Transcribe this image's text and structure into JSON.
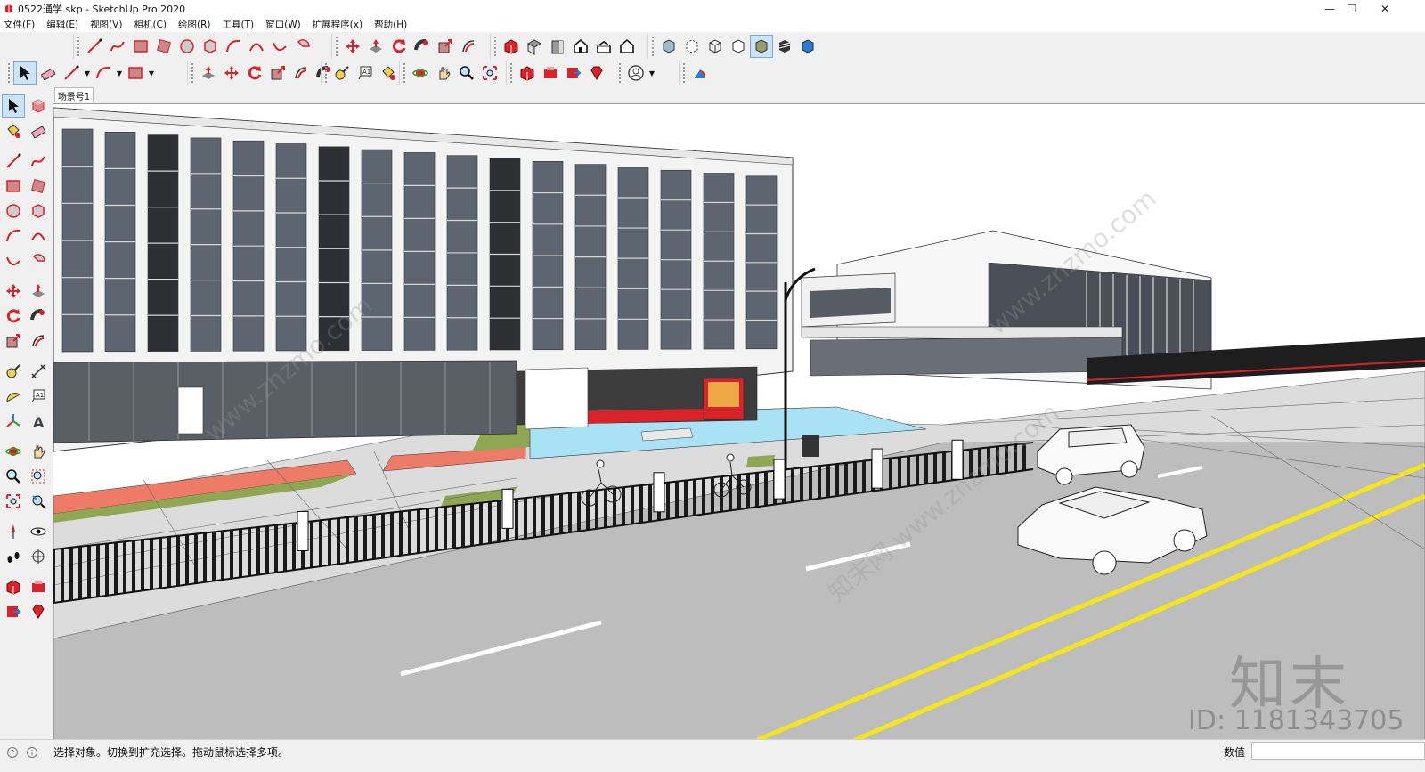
{
  "window": {
    "title": "0522通学.skp - SketchUp Pro 2020",
    "controls": [
      "minimize-icon",
      "restore-icon",
      "close-icon"
    ]
  },
  "menubar": {
    "items": [
      "文件(F)",
      "编辑(E)",
      "视图(V)",
      "相机(C)",
      "绘图(R)",
      "工具(T)",
      "窗口(W)",
      "扩展程序(x)",
      "帮助(H)"
    ]
  },
  "toolbars": {
    "top_row1_groups": [
      [
        "line-icon",
        "freehand-icon",
        "rectangle-icon",
        "rotated-rectangle-icon",
        "circle-icon",
        "polygon-icon",
        "arc-icon",
        "two-point-arc-icon",
        "three-point-arc-icon",
        "pie-icon"
      ],
      [
        "move-icon",
        "push-pull-icon",
        "rotate-icon",
        "follow-me-icon",
        "scale-icon",
        "offset-icon"
      ],
      [
        "warehouse-icon",
        "top-view-icon",
        "front-view-icon",
        "right-view-icon",
        "back-view-icon",
        "left-view-icon"
      ],
      [
        "xray-icon",
        "back-edges-icon",
        "wireframe-icon",
        "hidden-line-icon",
        "shaded-icon",
        "shaded-textures-icon",
        "monochrome-icon"
      ]
    ],
    "top_row2_groups": [
      [
        "select-icon",
        "eraser-icon",
        "line-icon",
        "arc-icon",
        "rectangle-icon"
      ],
      [
        "push-pull-icon",
        "move-icon",
        "rotate-icon",
        "scale-icon",
        "offset-icon",
        "follow-me-icon"
      ],
      [
        "tape-measure-icon",
        "text-icon",
        "paint-bucket-icon"
      ],
      [
        "orbit-icon",
        "pan-icon",
        "zoom-icon",
        "zoom-extents-icon"
      ],
      [
        "warehouse-icon",
        "extension-warehouse-icon",
        "send-to-layout-icon",
        "ruby-icon"
      ],
      [
        "user-icon"
      ],
      [
        "section-icon"
      ]
    ],
    "left_pairs": [
      [
        "select-icon",
        "make-component-icon"
      ],
      [
        "paint-bucket-icon",
        "eraser-icon"
      ],
      [
        "line-icon",
        "freehand-icon"
      ],
      [
        "rectangle-icon",
        "rotated-rectangle-icon"
      ],
      [
        "circle-icon",
        "polygon-icon"
      ],
      [
        "arc-icon",
        "two-point-arc-icon"
      ],
      [
        "three-point-arc-icon",
        "pie-icon"
      ],
      [
        "move-icon",
        "push-pull-icon"
      ],
      [
        "rotate-icon",
        "follow-me-icon"
      ],
      [
        "scale-icon",
        "offset-icon"
      ],
      [
        "tape-measure-icon",
        "dimension-icon"
      ],
      [
        "protractor-icon",
        "text-icon"
      ],
      [
        "axes-icon",
        "3d-text-icon"
      ],
      [
        "orbit-icon",
        "pan-icon"
      ],
      [
        "zoom-icon",
        "zoom-window-icon"
      ],
      [
        "zoom-extents-icon",
        "zoom-previous-icon"
      ],
      [
        "position-camera-icon",
        "look-around-icon"
      ],
      [
        "walk-icon",
        "section-plane-icon"
      ],
      [
        "warehouse-icon",
        "extension-warehouse-icon"
      ],
      [
        "send-to-layout-icon",
        "ruby-icon"
      ]
    ]
  },
  "scene_tab": "场景号1",
  "viewport": {
    "watermark_logo": "知末",
    "watermark_id": "ID: 1181343705"
  },
  "statusbar": {
    "hint": "选择对象。切换到扩充选择。拖动鼠标选择多项。",
    "measurements_label": "数值",
    "measurements_value": ""
  },
  "colors": {
    "accent_red": "#d8232a",
    "accent_blue": "#2b7bd3",
    "road": "#bcbcbc",
    "pool": "#a9e2f5",
    "bike_lane": "#ee7b67",
    "grass": "#8fa653",
    "lane_yellow": "#f7ea1b",
    "selected_tool_bg": "#cce4f7"
  }
}
